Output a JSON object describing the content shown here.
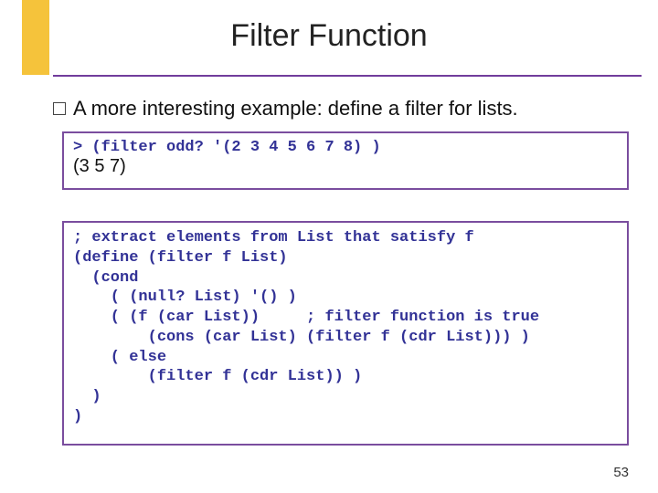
{
  "title": "Filter Function",
  "bullet": "A more interesting example:  define a filter for lists.",
  "box1": {
    "line1": "> (filter odd? '(2 3 4 5 6 7 8) )",
    "line2": "(3 5 7)"
  },
  "box2": {
    "line1": "; extract elements from List that satisfy f",
    "line2": "(define (filter f List)",
    "line3": "  (cond",
    "line4": "    ( (null? List) '() )",
    "line5": "    ( (f (car List))     ; filter function is true",
    "line6": "        (cons (car List) (filter f (cdr List))) )",
    "line7": "    ( else",
    "line8": "        (filter f (cdr List)) )",
    "line9": "  )",
    "line10": ")"
  },
  "page_number": "53"
}
